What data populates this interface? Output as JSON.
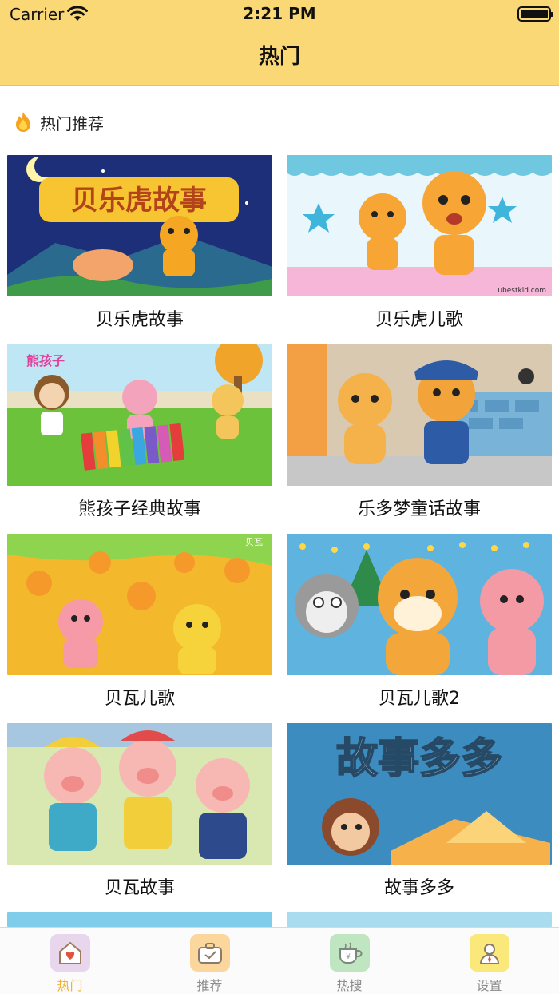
{
  "status_bar": {
    "carrier": "Carrier",
    "time": "2:21 PM"
  },
  "nav": {
    "title": "热门"
  },
  "section": {
    "title": "热门推荐",
    "icon": "flame-icon"
  },
  "items": [
    {
      "label": "贝乐虎故事",
      "thumb_text": "贝乐虎故事"
    },
    {
      "label": "贝乐虎儿歌",
      "thumb_text": "ubestkid.com"
    },
    {
      "label": "熊孩子经典故事",
      "thumb_text": "熊孩子"
    },
    {
      "label": "乐多梦童话故事"
    },
    {
      "label": "贝瓦儿歌",
      "thumb_text": "贝瓦"
    },
    {
      "label": "贝瓦儿歌2"
    },
    {
      "label": "贝瓦故事"
    },
    {
      "label": "故事多多",
      "thumb_text": "故事多多"
    }
  ],
  "tabs": [
    {
      "label": "热门",
      "icon": "house-heart-icon",
      "color": "#e8d6ec",
      "active": true
    },
    {
      "label": "推荐",
      "icon": "briefcase-icon",
      "color": "#fbd79e",
      "active": false
    },
    {
      "label": "热搜",
      "icon": "coffee-cup-icon",
      "color": "#bfe5c1",
      "active": false
    },
    {
      "label": "设置",
      "icon": "person-icon",
      "color": "#fbe87a",
      "active": false
    }
  ],
  "colors": {
    "header": "#fbd876",
    "active_tab": "#f2b233",
    "inactive_tab": "#8c8c8c"
  }
}
